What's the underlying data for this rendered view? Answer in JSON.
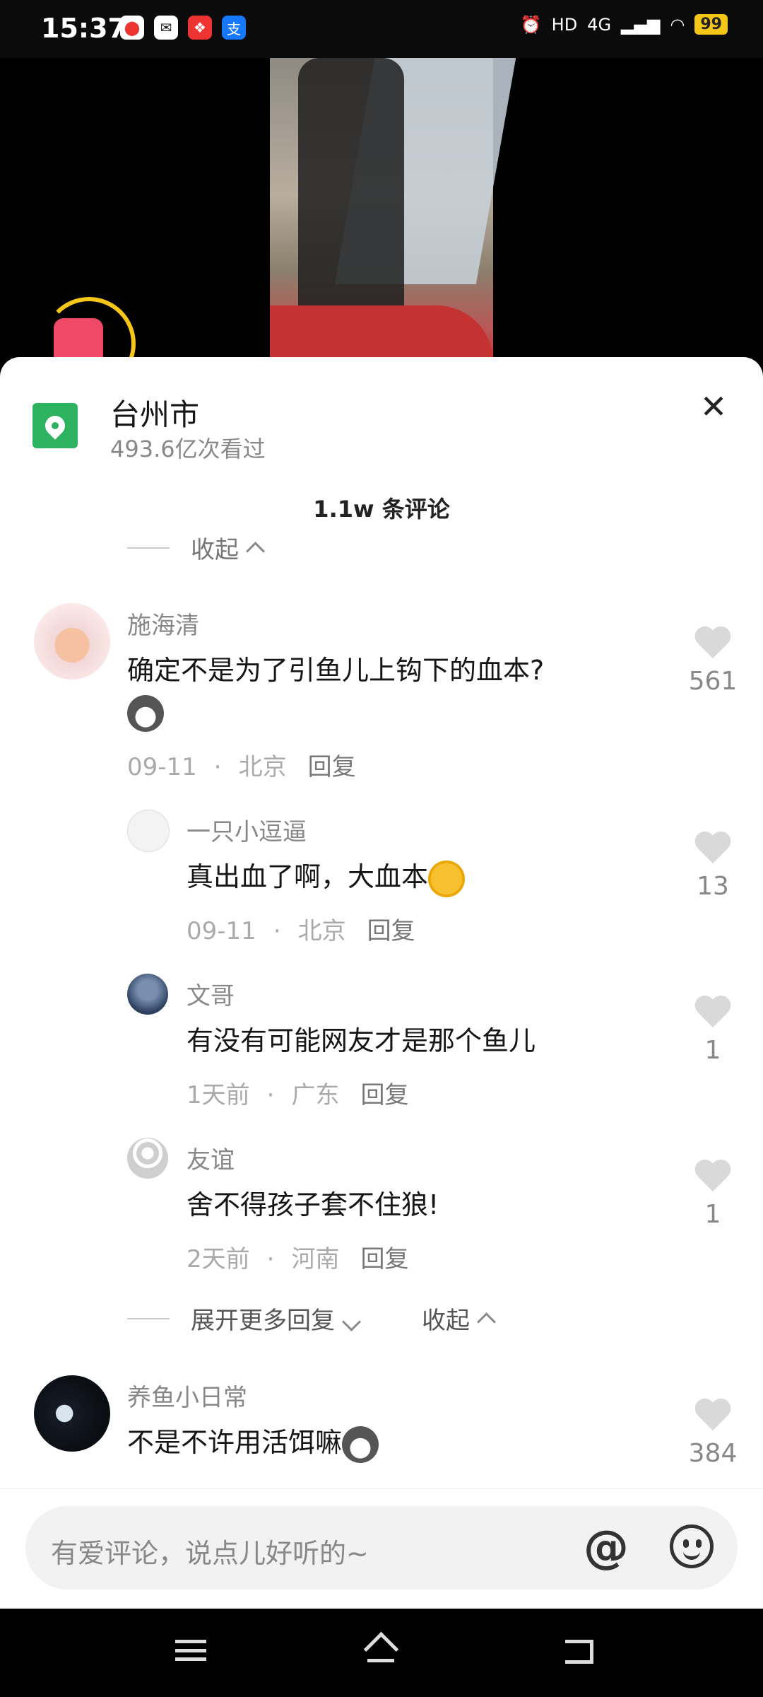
{
  "status": {
    "time": "15:37",
    "net": "4G",
    "hd": "HD",
    "battery": "99",
    "apps": [
      "map-app-icon",
      "mail-app-icon",
      "red-app-icon",
      "alipay-icon"
    ]
  },
  "location": {
    "title": "台州市",
    "subtitle": "493.6亿次看过"
  },
  "comments_header": {
    "count": "1.1w  条评论",
    "collapse": "收起"
  },
  "comments": [
    {
      "user": "施海清",
      "text": "确定不是为了引鱼儿上钩下的血本?",
      "date": "09-11",
      "place": "北京",
      "reply": "回复",
      "likes": "561"
    },
    {
      "user": "一只小逗逼",
      "text": "真出血了啊，大血本",
      "date": "09-11",
      "place": "北京",
      "reply": "回复",
      "likes": "13"
    },
    {
      "user": "文哥",
      "text": "有没有可能网友才是那个鱼儿",
      "date": "1天前",
      "place": "广东",
      "reply": "回复",
      "likes": "1"
    },
    {
      "user": "友谊",
      "text": "舍不得孩子套不住狼!",
      "date": "2天前",
      "place": "河南",
      "reply": "回复",
      "likes": "1"
    },
    {
      "user": "养鱼小日常",
      "text": "不是不许用活饵嘛",
      "likes": "384"
    }
  ],
  "more_replies": {
    "expand": "展开更多回复",
    "collapse": "收起"
  },
  "input": {
    "placeholder": "有爱评论，说点儿好听的~",
    "at": "@"
  },
  "close_glyph": "✕"
}
